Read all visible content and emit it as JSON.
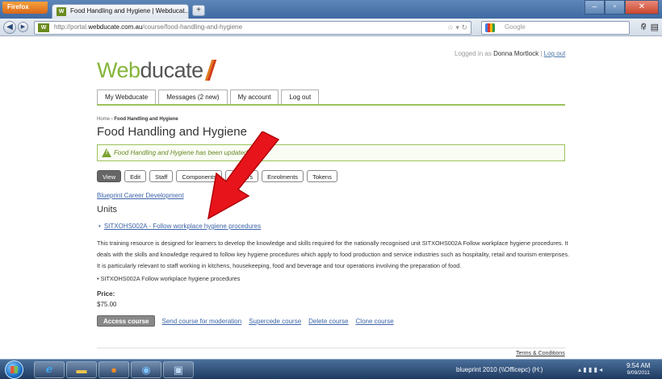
{
  "browser": {
    "app_button": "Firefox",
    "tab_title": "Food Handling and Hygiene | Webducat...",
    "new_tab": "+",
    "url_prefix": "http://portal.",
    "url_domain": "webducate.com.au",
    "url_path": "/course/food-handling-and-hygiene",
    "search_placeholder": "Google"
  },
  "header": {
    "logged_in_label": "Logged in as",
    "username": "Donna Mortlock",
    "separator": "|",
    "logout_link": "Log out",
    "logo_part1": "Web",
    "logo_part2": "ducate"
  },
  "main_nav": [
    "My Webducate",
    "Messages (2 new)",
    "My account",
    "Log out"
  ],
  "breadcrumb": {
    "home": "Home",
    "separator": "›",
    "current": "Food Handling and Hygiene"
  },
  "page_title": "Food Handling and Hygiene",
  "alert_message": "Food Handling and Hygiene has been updated.",
  "sub_tabs": [
    "View",
    "Edit",
    "Staff",
    "Components",
    "Trainers",
    "Enrolments",
    "Tokens"
  ],
  "content": {
    "career_link": "Blueprint Career Development",
    "units_heading": "Units",
    "unit_item": "SITXOHS002A - Follow workplace hygiene procedures",
    "description": "This training resource is designed for learners to develop the knowledge and skills required for the nationally recognised unit SITXOHS002A Follow workplace hygiene procedures. It deals with the skills and knowledge required to follow key hygiene procedures which apply to food production and service industries such as hospitality, retail and tourism enterprises. It is particularly relevant to staff working in kitchens, housekeeping, food and beverage and tour operations involving the preparation of food.",
    "description_bullet": "• SITXOHS002A Follow workplace hygiene procedures",
    "price_label": "Price:",
    "price_value": "$75.00"
  },
  "actions": {
    "access_course": "Access course",
    "send_moderation": "Send course for moderation",
    "supercede": "Supercede course",
    "delete": "Delete course",
    "clone": "Clone course"
  },
  "footer": {
    "terms": "Terms & Conditions"
  },
  "taskbar": {
    "active_window": "blueprint 2010 (\\\\Officepc) (H:)",
    "time": "9:54 AM",
    "date": "9/09/2011"
  },
  "colors": {
    "brand_green": "#86b53a",
    "link_blue": "#3b63a8",
    "annotation_red": "#e8141b"
  }
}
